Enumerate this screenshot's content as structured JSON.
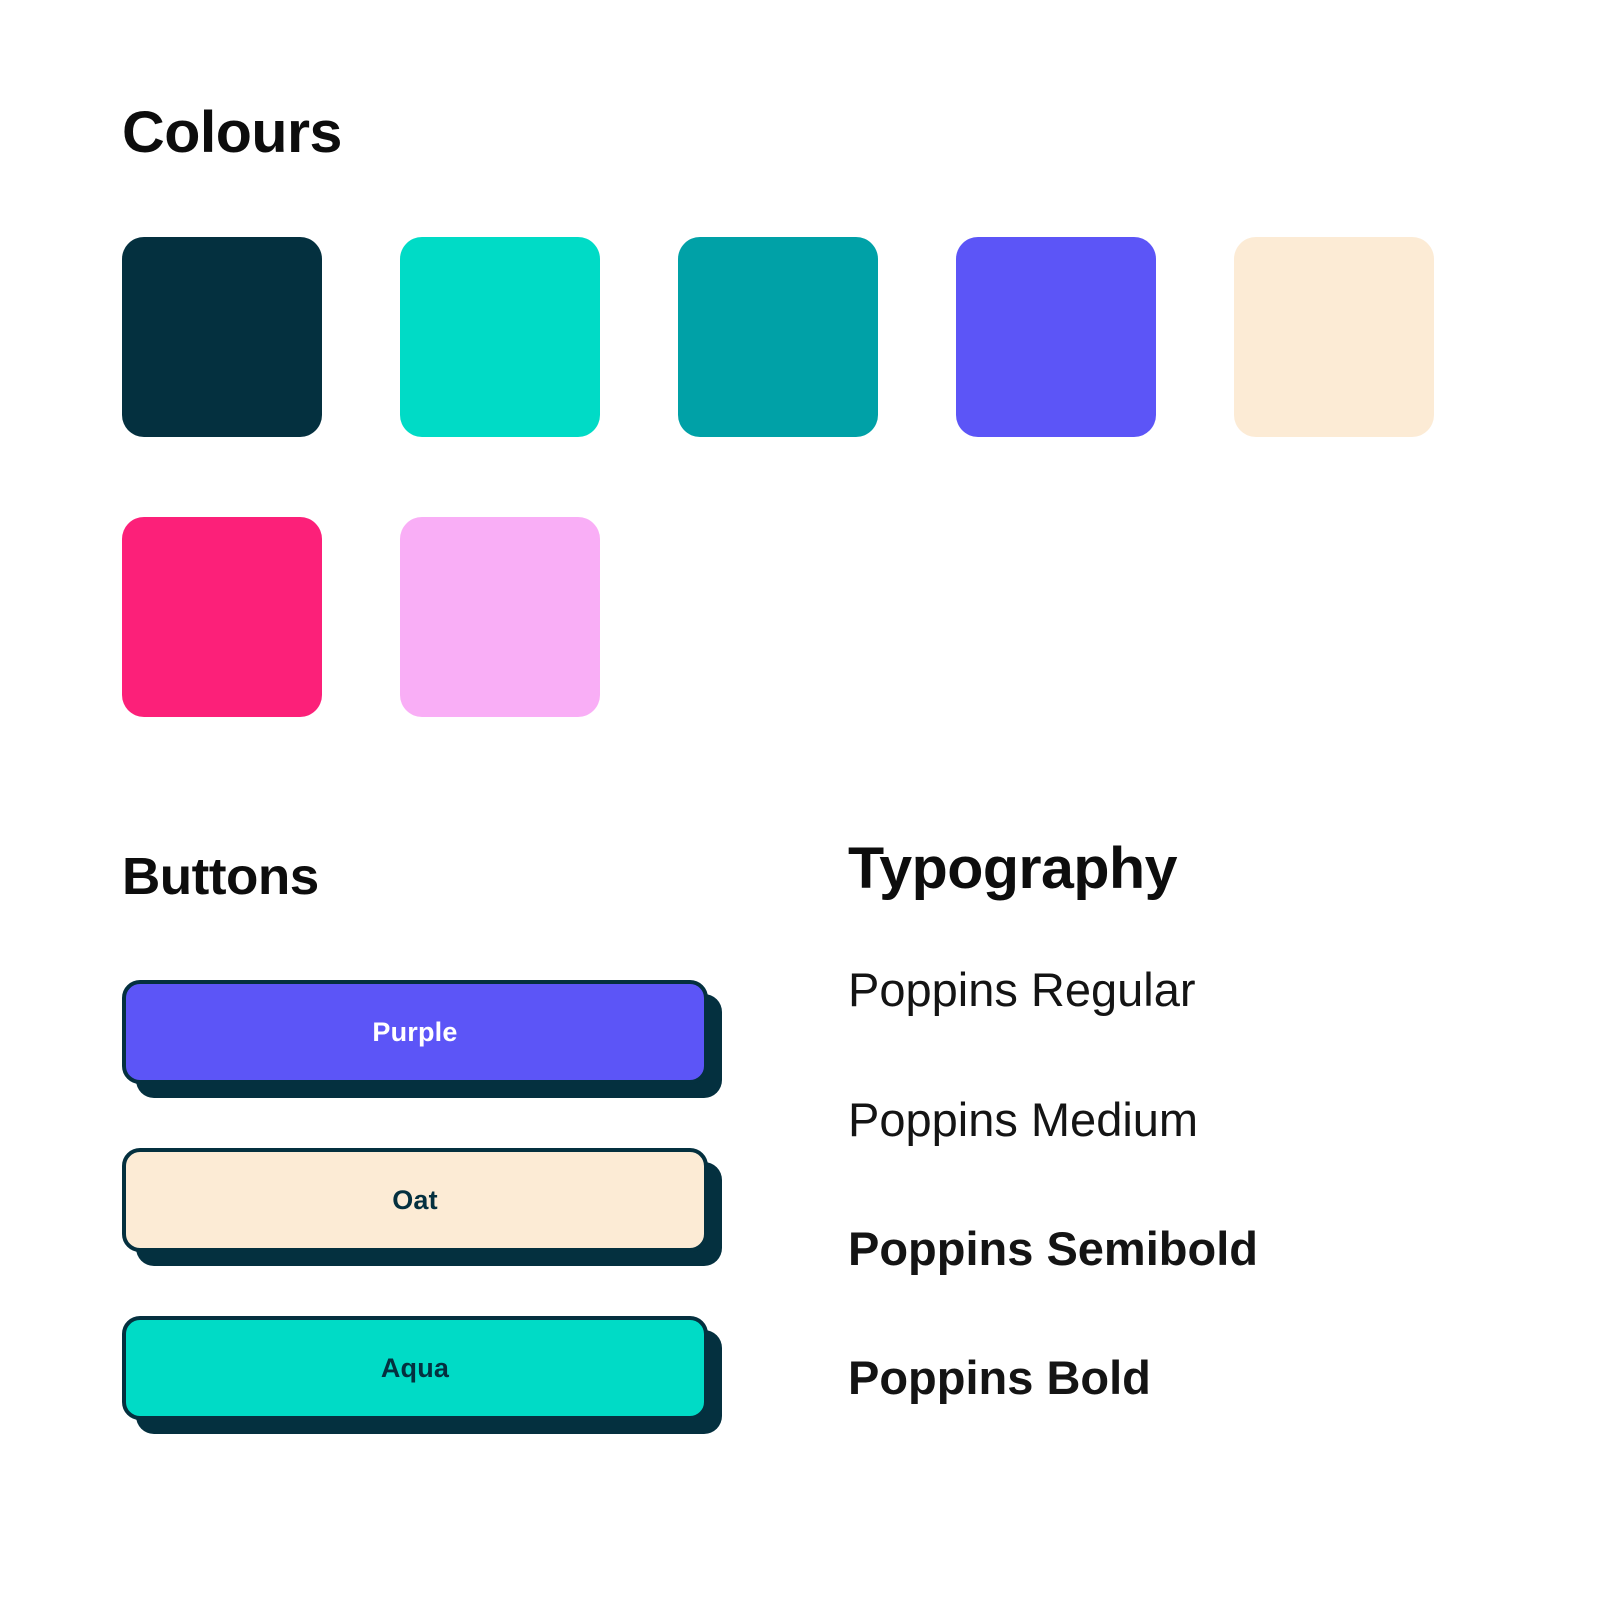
{
  "sections": {
    "colours_title": "Colours",
    "buttons_title": "Buttons",
    "typography_title": "Typography"
  },
  "colours": {
    "swatches": [
      {
        "name": "navy",
        "hex": "#04303F"
      },
      {
        "name": "aqua",
        "hex": "#00DBC6"
      },
      {
        "name": "teal",
        "hex": "#00A1A7"
      },
      {
        "name": "purple",
        "hex": "#5C55F7"
      },
      {
        "name": "oat",
        "hex": "#FCEBD5"
      },
      {
        "name": "pink",
        "hex": "#FC2079"
      },
      {
        "name": "light-pink",
        "hex": "#F9AEF6"
      }
    ]
  },
  "buttons": {
    "items": [
      {
        "label": "Purple",
        "fill": "#5C55F7",
        "text_color": "#FFFFFF",
        "border_color": "#04303F",
        "shadow_color": "#04303F"
      },
      {
        "label": "Oat",
        "fill": "#FCEBD5",
        "text_color": "#04303F",
        "border_color": "#04303F",
        "shadow_color": "#04303F"
      },
      {
        "label": "Aqua",
        "fill": "#00DBC6",
        "text_color": "#04303F",
        "border_color": "#04303F",
        "shadow_color": "#04303F"
      }
    ]
  },
  "typography": {
    "samples": [
      {
        "label": "Poppins Regular",
        "weight": "400"
      },
      {
        "label": "Poppins Medium",
        "weight": "500"
      },
      {
        "label": "Poppins Semibold",
        "weight": "600"
      },
      {
        "label": "Poppins Bold",
        "weight": "700"
      }
    ]
  }
}
